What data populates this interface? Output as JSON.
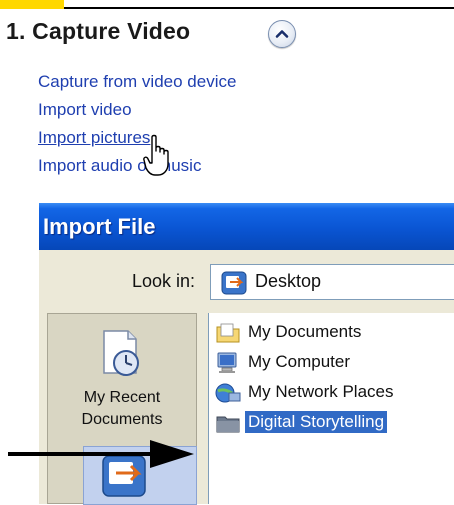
{
  "header": {
    "section_title": "1. Capture Video",
    "collapse_icon": "chevron-up-icon"
  },
  "tasks": [
    {
      "label": "Capture from video device"
    },
    {
      "label": "Import video"
    },
    {
      "label": "Import pictures"
    },
    {
      "label": "Import audio or music"
    }
  ],
  "dialog": {
    "title": "Import File",
    "look_in_label": "Look in:",
    "look_in_value": "Desktop",
    "places": [
      {
        "label": "My Recent Documents",
        "icon": "recent-documents-icon"
      },
      {
        "label": "",
        "icon": "desktop-icon"
      }
    ],
    "files": [
      {
        "name": "My Documents",
        "icon": "folder-icon"
      },
      {
        "name": "My Computer",
        "icon": "computer-icon"
      },
      {
        "name": "My Network Places",
        "icon": "network-icon"
      },
      {
        "name": "Digital Storytelling",
        "icon": "folder-icon",
        "selected": true
      }
    ]
  },
  "colors": {
    "link": "#1f3fb0",
    "title_bar": "#0a55d3",
    "selection": "#316ac5",
    "highlight_tab": "#ffd800"
  }
}
